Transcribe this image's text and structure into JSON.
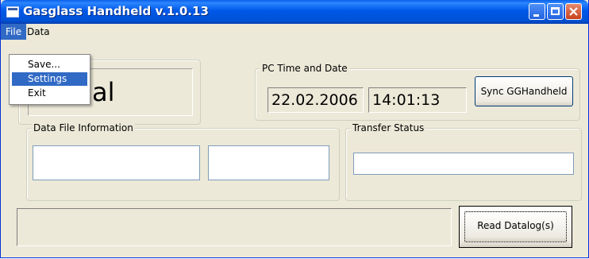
{
  "window": {
    "title": "Gasglass Handheld v.1.0.13"
  },
  "menubar": {
    "file": "File",
    "data": "Data"
  },
  "file_menu": {
    "items": [
      "Save...",
      "Settings",
      "Exit"
    ],
    "selected": "Settings"
  },
  "top_left_box": {
    "text_fragment": "al"
  },
  "pc_time": {
    "label": "PC Time and Date",
    "date": "22.02.2006",
    "time": "14:01:13",
    "sync_button": "Sync GGHandheld"
  },
  "data_file": {
    "label": "Data File Information",
    "field1": "",
    "field2": ""
  },
  "transfer": {
    "label": "Transfer Status",
    "value": ""
  },
  "status_bar": {
    "value": ""
  },
  "read_button": "Read Datalog(s)",
  "colors": {
    "title_bar": "#0058e8",
    "menu_highlight": "#316ac5",
    "window_bg": "#ece9d8"
  }
}
